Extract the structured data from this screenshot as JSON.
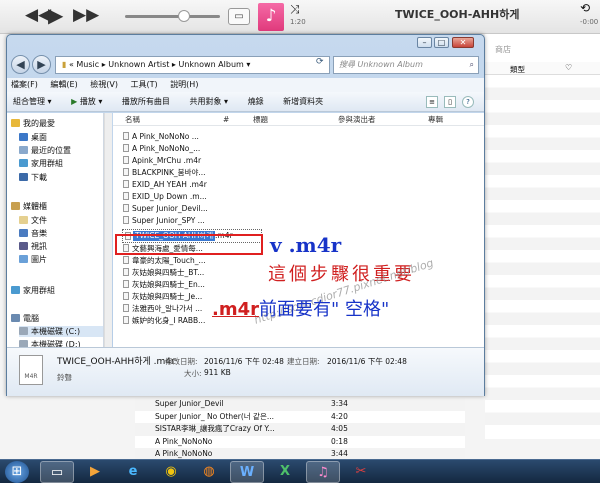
{
  "itunes": {
    "now_playing": "TWICE_OOH-AHH하게",
    "time_elapsed": "1:20",
    "time_remaining": "-0:00",
    "store_label": "商店",
    "col_genre": "類型",
    "songs": [
      {
        "title": "Super Junior_Devil",
        "time": "3:34"
      },
      {
        "title": "Super Junior_ No Other(너 같은...",
        "time": "4:20"
      },
      {
        "title": "SISTAR李琳_讓我瘋了Crazy Of Y...",
        "time": "4:05"
      },
      {
        "title": "A Pink_NoNoNo",
        "time": "0:18"
      },
      {
        "title": "A Pink_NoNoNo",
        "time": "3:44"
      }
    ]
  },
  "explorer": {
    "breadcrumb": [
      "«",
      "Music",
      "Unknown Artist",
      "Unknown Album"
    ],
    "search_placeholder": "搜尋 Unknown Album",
    "menu": [
      "檔案(F)",
      "編輯(E)",
      "檢視(V)",
      "工具(T)",
      "說明(H)"
    ],
    "toolbar": [
      "組合管理 ▾",
      "播放 ▾",
      "播放所有曲目",
      "共用對象 ▾",
      "燒錄",
      "新增資料夾"
    ],
    "nav": {
      "favorites": "我的最愛",
      "desktop": "桌面",
      "recent": "最近的位置",
      "homegroup_fav": "家用群組",
      "downloads": "下載",
      "libraries": "媒體櫃",
      "documents": "文件",
      "music": "音樂",
      "videos": "視訊",
      "pictures": "圖片",
      "homegroup": "家用群組",
      "computer": "電腦",
      "disk_c": "本機磁碟 (C:)",
      "disk_d": "本機磁碟 (D:)"
    },
    "columns": {
      "name": "名稱",
      "number": "#",
      "title": "標題",
      "artists": "參與演出者",
      "album": "專輯"
    },
    "files": [
      "A Pink_NoNoNo ...",
      "A Pink_NoNoNo_...",
      "Apink_MrChu .m4r",
      "BLACKPINK_붐바야...",
      "EXID_AH YEAH .m4r",
      "EXID_Up  Down .m...",
      "Super Junior_Devil...",
      "Super Junior_SPY ...",
      "文藝興海處_愛情每...",
      "韋豪的太陽_Touch_...",
      "灰姑娘與四騎士_BT...",
      "灰姑娘與四騎士_En...",
      "灰姑娘與四騎士_Je...",
      "法雅西아_알나가서 ...",
      "嫉妒的化身_I RABB..."
    ],
    "rename_selected": "TWICE_OOH-AHH하게",
    "rename_ext": ".m4r",
    "details": {
      "filename": "TWICE_OOH-AHH하게 .m4r",
      "modified_label": "修改日期:",
      "modified": "2016/11/6 下午 02:48",
      "created_label": "建立日期:",
      "created": "2016/11/6 下午 02:48",
      "type": "鈴聲",
      "size_label": "大小:",
      "size": "911 KB",
      "thumb": "M4R"
    }
  },
  "annotations": {
    "check": "v",
    "ext": ".m4r",
    "note1": "這個步驟很重要",
    "note2_ext": ".m4r",
    "note2": "前面要有\" 空格\"",
    "watermark": "http://sonccdior77.pixnet.net/blog"
  },
  "taskbar": [
    "start",
    "explorer",
    "media-player",
    "ie",
    "chrome",
    "firefox",
    "word",
    "excel",
    "itunes",
    "snip"
  ],
  "colors": {
    "selection": "#3a78d1",
    "annotation_blue": "#1733c8",
    "annotation_red": "#d02020"
  }
}
